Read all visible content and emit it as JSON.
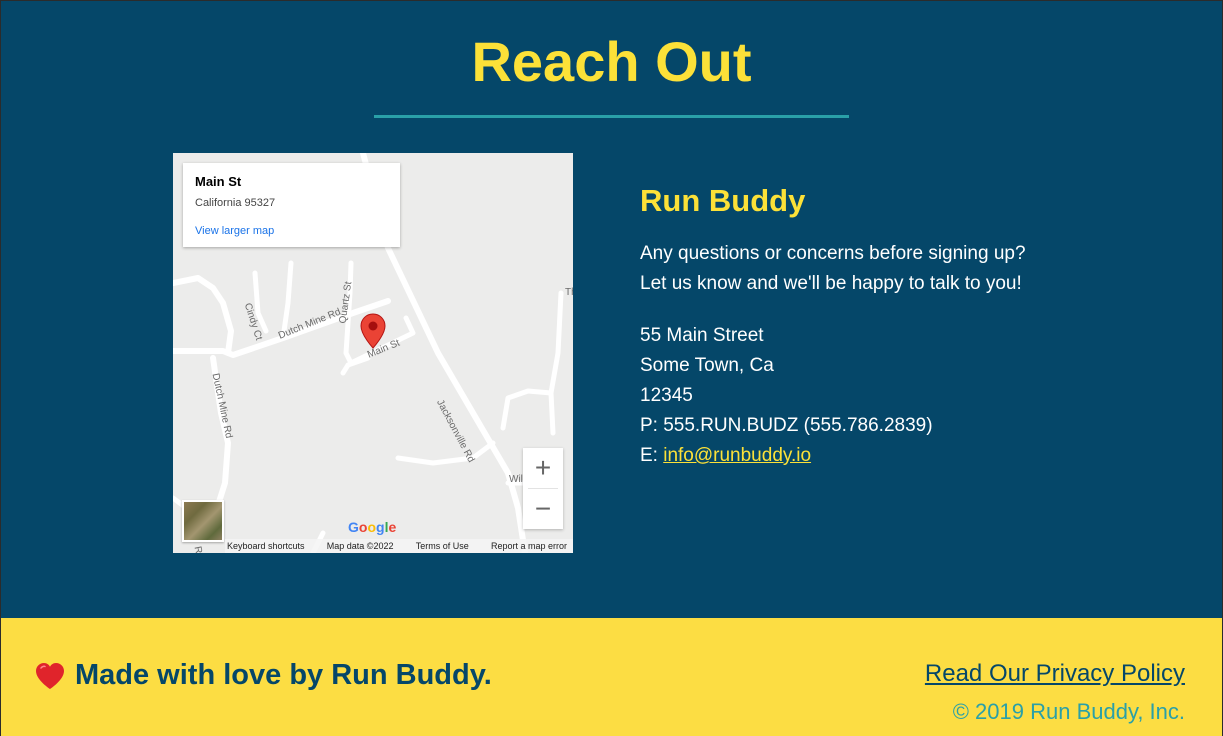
{
  "contact": {
    "title": "Reach Out",
    "map": {
      "card_title": "Main St",
      "card_subtitle": "California 95327",
      "card_link": "View larger map",
      "road_labels": [
        "Cindy Ct",
        "Dutch Mine Rd",
        "Quartz St",
        "Main St",
        "Dutch Mine Rd",
        "Jacksonville Rd",
        "Wil",
        "Th",
        "Rd"
      ],
      "zoom_in": "+",
      "zoom_out": "−",
      "logo": [
        "G",
        "o",
        "o",
        "g",
        "l",
        "e"
      ],
      "footer": {
        "shortcuts": "Keyboard shortcuts",
        "map_data": "Map data ©2022",
        "terms": "Terms of Use",
        "report": "Report a map error"
      }
    },
    "company": "Run Buddy",
    "message_line1": "Any questions or concerns before signing up?",
    "message_line2": "Let us know and we'll be happy to talk to you!",
    "address_line1": "55 Main Street",
    "address_line2": "Some Town, Ca",
    "address_line3": "12345",
    "phone": "P: 555.RUN.BUDZ (555.786.2839)",
    "email_prefix": "E: ",
    "email": "info@runbuddy.io"
  },
  "footer": {
    "made_with": "Made with love by Run Buddy.",
    "privacy": "Read Our Privacy Policy",
    "copyright": "© 2019 Run Buddy, Inc."
  },
  "colors": {
    "primary": "#054769",
    "accent": "#fce138",
    "teal": "#2aa0a8",
    "footer_bg": "#fcdd43",
    "pin": "#ea4335"
  }
}
